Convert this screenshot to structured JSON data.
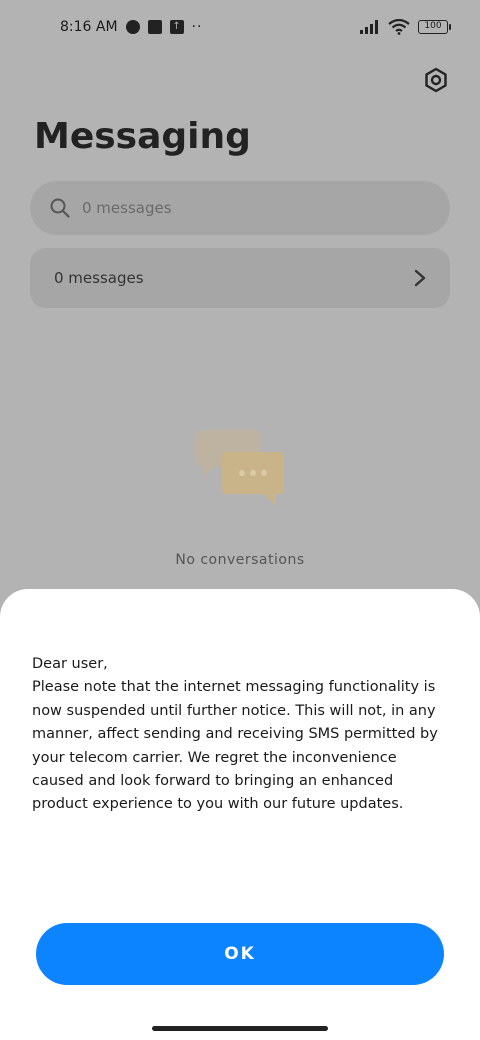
{
  "status_bar": {
    "time": "8:16 AM",
    "dots": "··",
    "battery": "100"
  },
  "header": {
    "title": "Messaging"
  },
  "search": {
    "placeholder": "0 messages"
  },
  "messages_row": {
    "label": "0 messages"
  },
  "empty_state": {
    "text": "No conversations"
  },
  "dialog": {
    "greeting": "Dear user,",
    "body": "Please note that the internet messaging functionality is now suspended until further notice. This will not, in any manner, affect sending and receiving SMS permitted by your telecom carrier. We regret the inconvenience caused and look forward to bringing an enhanced product experience to you with our future updates.",
    "ok_label": "OK"
  },
  "colors": {
    "primary_button": "#0d84ff",
    "overlay_background": "#b3b3b3",
    "illustration_accent": "#c9b48a"
  }
}
